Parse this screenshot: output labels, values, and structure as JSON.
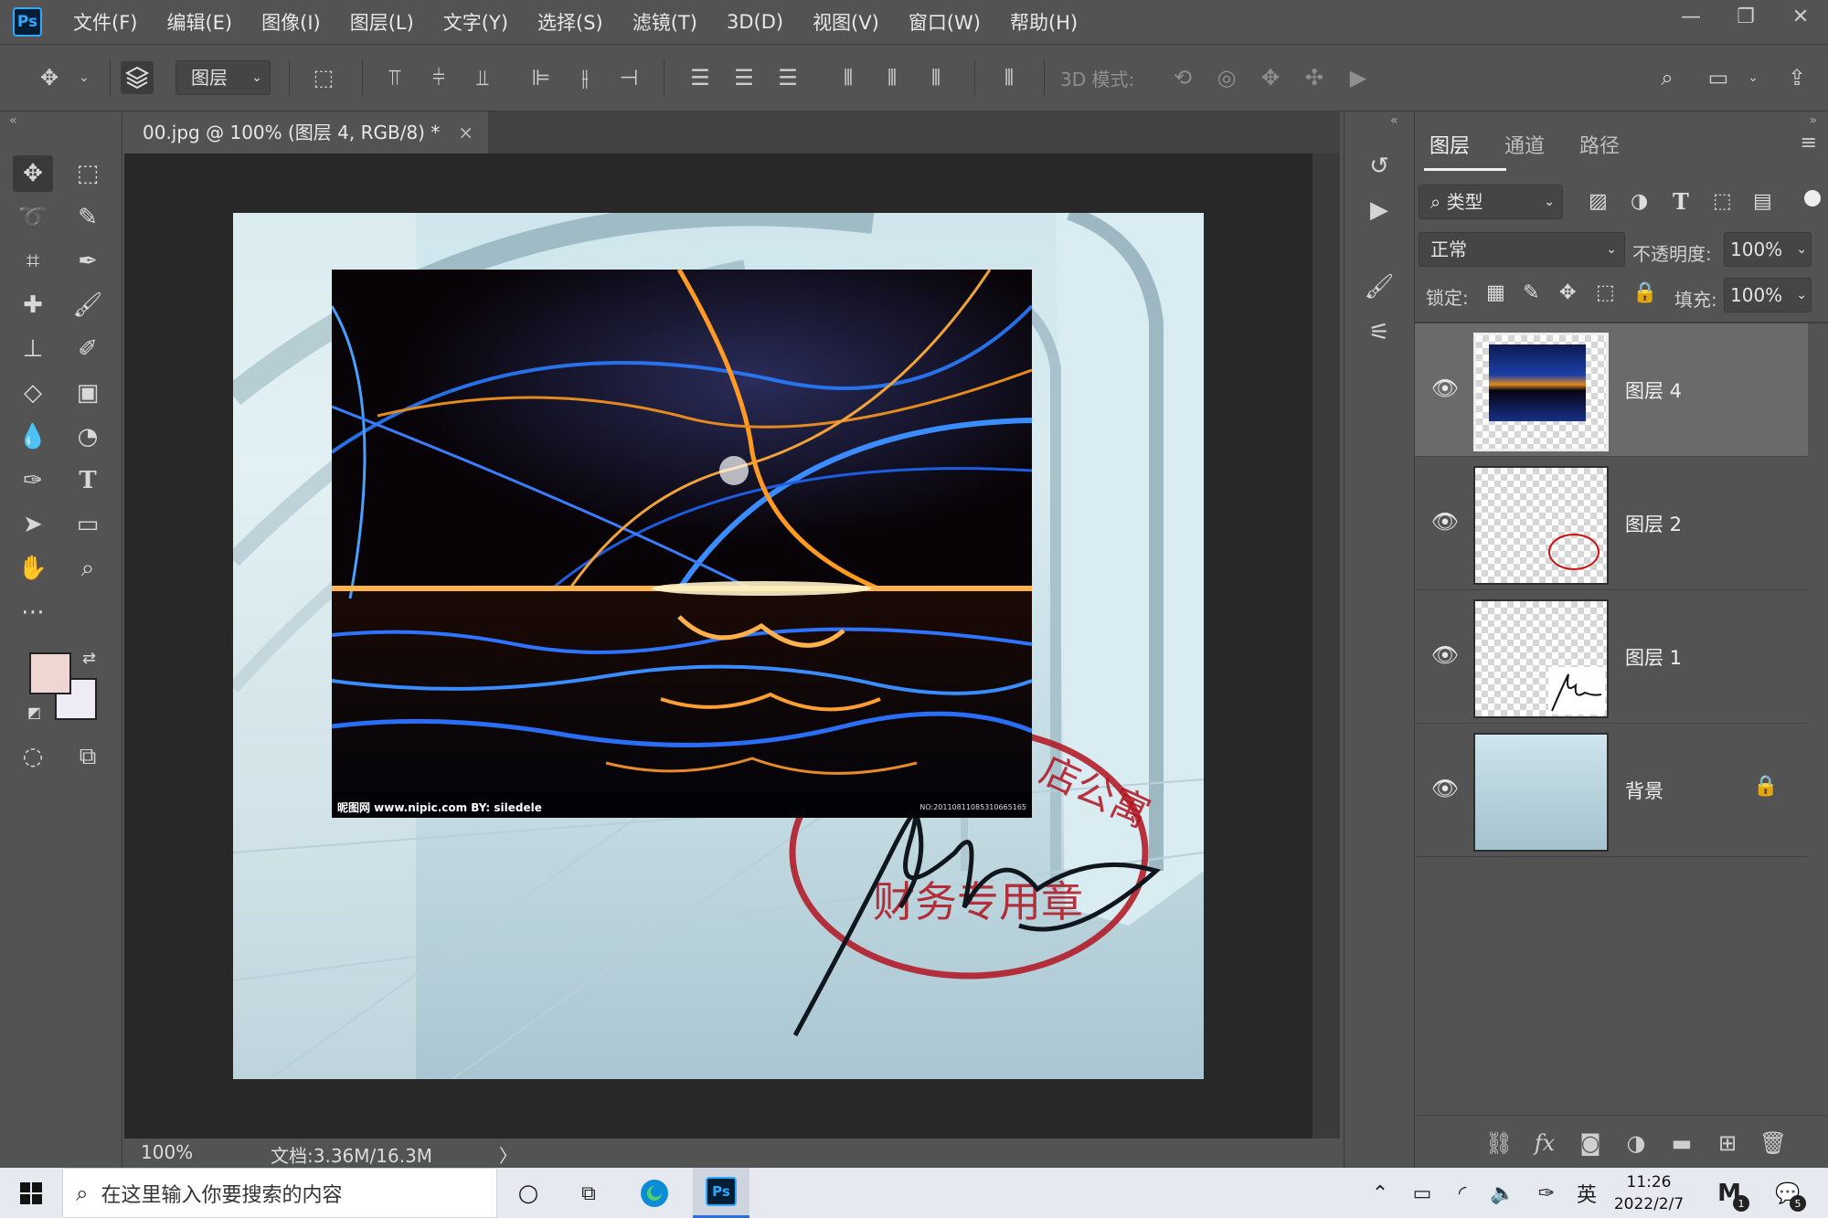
{
  "app": {
    "logo": "Ps"
  },
  "menu": [
    "文件(F)",
    "编辑(E)",
    "图像(I)",
    "图层(L)",
    "文字(Y)",
    "选择(S)",
    "滤镜(T)",
    "3D(D)",
    "视图(V)",
    "窗口(W)",
    "帮助(H)"
  ],
  "window_controls": {
    "minimize": "—",
    "restore": "❐",
    "close": "✕"
  },
  "options": {
    "auto_select_target": "图层",
    "mode_3d_label": "3D 模式:"
  },
  "document": {
    "tab_title": "00.jpg @ 100% (图层 4, RGB/8) *",
    "tab_close": "×",
    "zoom": "100%",
    "doc_info": "文档:3.36M/16.3M",
    "arrow": "〉"
  },
  "colors": {
    "foreground": "#f0d6d2",
    "background": "#eeebf7",
    "accent": "#31a8ff"
  },
  "overlay": {
    "watermark_left": "昵图网 www.nipic.com   BY: siledele",
    "watermark_right": "NO:20110811085310665165"
  },
  "panel": {
    "tabs": [
      "图层",
      "通道",
      "路径"
    ],
    "filter_label": "类型",
    "blend_mode": "正常",
    "opacity_label": "不透明度:",
    "opacity_value": "100%",
    "lock_label": "锁定:",
    "fill_label": "填充:",
    "fill_value": "100%",
    "layers": [
      {
        "name": "图层 4",
        "visible": true,
        "selected": true
      },
      {
        "name": "图层 2",
        "visible": true,
        "selected": false
      },
      {
        "name": "图层 1",
        "visible": true,
        "selected": false
      },
      {
        "name": "背景",
        "visible": true,
        "selected": false,
        "locked": true
      }
    ]
  },
  "taskbar": {
    "search_placeholder": "在这里输入你要搜索的内容",
    "ime": "英",
    "time": "11:26",
    "date": "2022/2/7",
    "notification_count": "5",
    "m_badge": "1"
  }
}
